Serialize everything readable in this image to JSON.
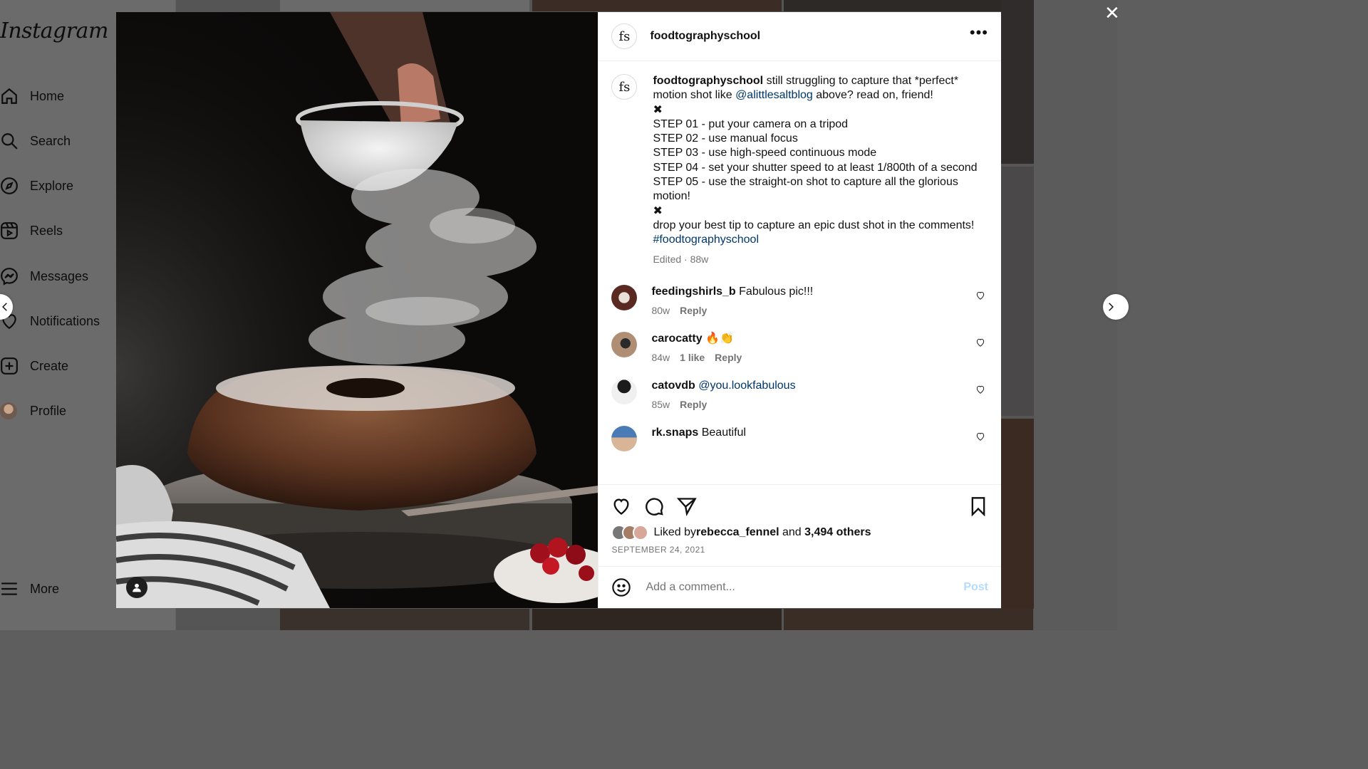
{
  "sidebar": {
    "logo": "Instagram",
    "items": [
      {
        "label": "Home",
        "icon": "home-icon"
      },
      {
        "label": "Search",
        "icon": "search-icon"
      },
      {
        "label": "Explore",
        "icon": "compass-icon"
      },
      {
        "label": "Reels",
        "icon": "reels-icon"
      },
      {
        "label": "Messages",
        "icon": "messenger-icon"
      },
      {
        "label": "Notifications",
        "icon": "heart-icon"
      },
      {
        "label": "Create",
        "icon": "plus-square-icon"
      },
      {
        "label": "Profile",
        "icon": "profile-avatar"
      }
    ],
    "more_label": "More"
  },
  "post": {
    "author": "foodtographyschool",
    "author_avatar_text": "fs",
    "caption": {
      "username": "foodtographyschool",
      "line1_a": "still struggling to capture that *perfect* motion shot like ",
      "mention": "@alittlesaltblog",
      "line1_b": " above? read on, friend!",
      "sep": "✖",
      "steps": [
        "STEP 01 - put your camera on a tripod",
        "STEP 02 - use manual focus",
        "STEP 03 - use high-speed continuous mode",
        "STEP 04 - set your shutter speed to at least 1/800th of a second",
        "STEP 05 - use the straight-on shot to capture all the glorious motion!"
      ],
      "closing": "drop your best tip to capture an epic dust shot in the comments! ",
      "hashtag": "#foodtographyschool",
      "meta": "Edited · 88w"
    },
    "comments": [
      {
        "username": "feedingshirls_b",
        "text": "Fabulous pic!!!",
        "mention": "",
        "age": "80w",
        "likes": "",
        "reply": "Reply",
        "avatar_color": "#5a2a22"
      },
      {
        "username": "carocatty",
        "text": "🔥👏",
        "mention": "",
        "age": "84w",
        "likes": "1 like",
        "reply": "Reply",
        "avatar_color": "#8a6a55"
      },
      {
        "username": "catovdb",
        "text": "",
        "mention": "@you.lookfabulous",
        "age": "85w",
        "likes": "",
        "reply": "Reply",
        "avatar_color": "#3a3a3a"
      },
      {
        "username": "rk.snaps",
        "text": "Beautiful",
        "mention": "",
        "age": "",
        "likes": "",
        "reply": "",
        "avatar_color": "#4a7bb5"
      }
    ],
    "liked_by_prefix": "Liked by ",
    "liked_by_user": "rebecca_fennel",
    "liked_by_mid": " and ",
    "liked_by_count": "3,494 others",
    "date": "SEPTEMBER 24, 2021",
    "comment_placeholder": "Add a comment...",
    "post_label": "Post"
  },
  "colors": {
    "link": "#00376b",
    "post_button": "#b3dbff",
    "overlay": "#5e5e5e"
  }
}
